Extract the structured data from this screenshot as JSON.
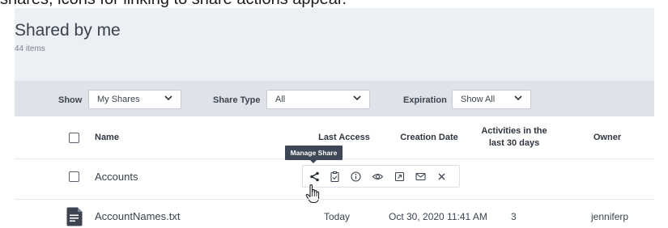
{
  "caption": "shares, icons for linking to share actions appear.",
  "header": {
    "title": "Shared by me",
    "count": "44 items"
  },
  "filters": {
    "show_label": "Show",
    "show_value": "My Shares",
    "share_type_label": "Share Type",
    "share_type_value": "All",
    "expiration_label": "Expiration",
    "expiration_value": "Show All"
  },
  "columns": {
    "name": "Name",
    "last_access": "Last Access",
    "creation_date": "Creation Date",
    "activities_line1": "Activities in the",
    "activities_line2": "last 30 days",
    "owner": "Owner"
  },
  "rows": [
    {
      "name": "Accounts",
      "type": "folder"
    },
    {
      "name": "AccountNames.txt",
      "type": "file",
      "last_access": "Today",
      "creation_date": "Oct 30, 2020 11:41 AM",
      "activities": "3",
      "owner": "jenniferp"
    }
  ],
  "tooltip": "Manage Share",
  "actions": [
    "share-icon",
    "clipboard-check-icon",
    "info-icon",
    "eye-icon",
    "open-external-icon",
    "mail-icon",
    "close-icon"
  ]
}
